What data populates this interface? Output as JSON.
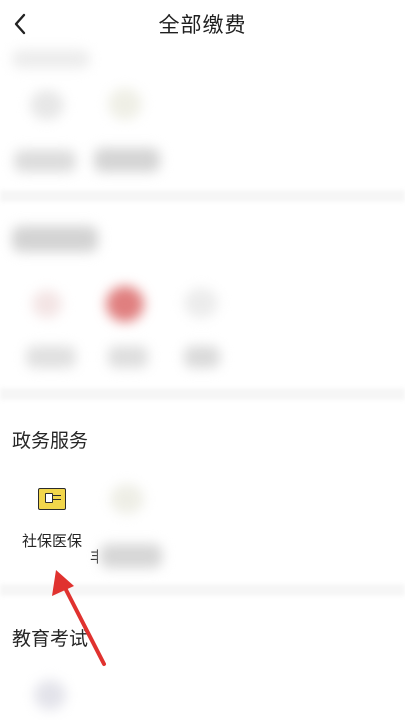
{
  "header": {
    "title": "全部缴费"
  },
  "sections": [
    {
      "title": "政务服务",
      "items": [
        {
          "label": "社保医保"
        }
      ]
    },
    {
      "title": "教育考试"
    }
  ],
  "partial_label": "丰",
  "colors": {
    "accent_red": "#e0322f",
    "icon_yellow": "#f2d64b"
  },
  "icons": [
    "back-chevron-icon",
    "social-security-icon",
    "red-arrow-pointer"
  ]
}
